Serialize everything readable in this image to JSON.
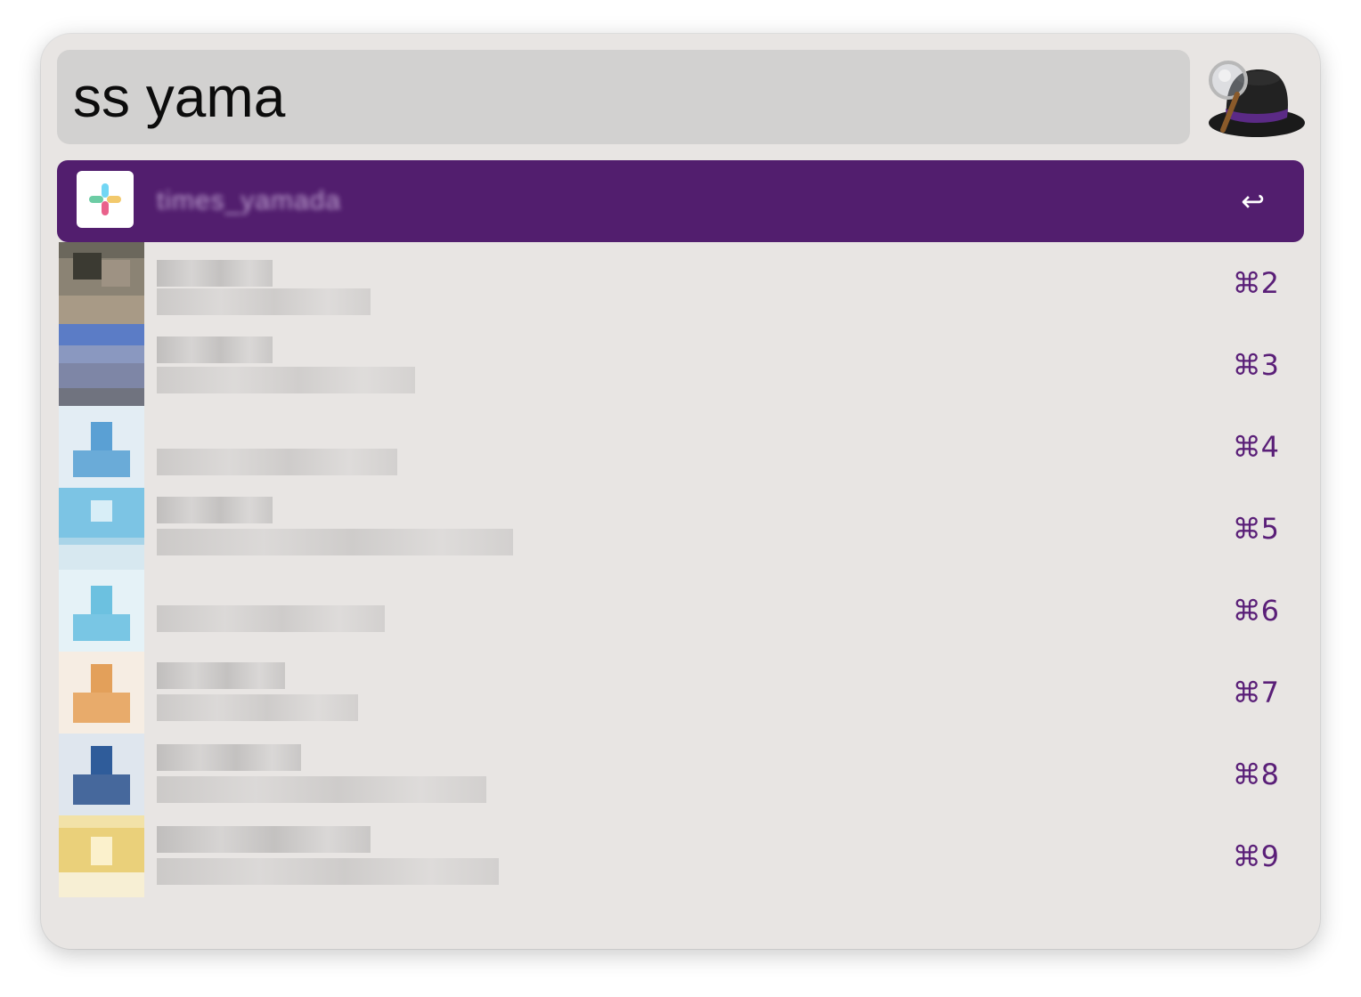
{
  "search": {
    "query": "ss yama"
  },
  "results": [
    {
      "title": "times_yamada",
      "shortcut": "↩",
      "selected": true,
      "icon": "slack-icon"
    },
    {
      "title": "",
      "shortcut": "⌘2",
      "icon": "avatar-photo"
    },
    {
      "title": "",
      "shortcut": "⌘3",
      "icon": "avatar-photo"
    },
    {
      "title": "",
      "shortcut": "⌘4",
      "icon": "avatar-default"
    },
    {
      "title": "",
      "shortcut": "⌘5",
      "icon": "avatar-default"
    },
    {
      "title": "",
      "shortcut": "⌘6",
      "icon": "avatar-default"
    },
    {
      "title": "",
      "shortcut": "⌘7",
      "icon": "avatar-default"
    },
    {
      "title": "",
      "shortcut": "⌘8",
      "icon": "avatar-default"
    },
    {
      "title": "",
      "shortcut": "⌘9",
      "icon": "avatar-default"
    }
  ],
  "colors": {
    "selection": "#521e6e",
    "shortcut": "#5a1f78",
    "window_bg": "#e8e5e3",
    "search_bg": "#d2d1d0"
  }
}
